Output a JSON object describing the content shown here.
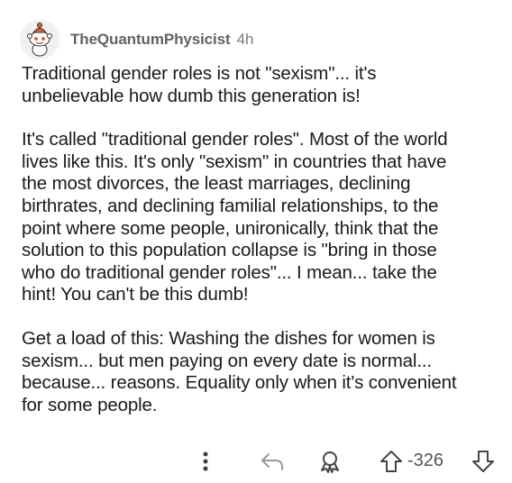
{
  "comment": {
    "username": "TheQuantumPhysicist",
    "timestamp": "4h",
    "paragraphs": [
      "Traditional gender roles is not \"sexism\"... it's\nunbelievable how dumb this generation is!",
      "It's called \"traditional gender roles\". Most of the world\nlives like this. It's only \"sexism\" in countries that have\nthe most divorces, the least marriages, declining\nbirthrates, and declining familial relationships, to the\npoint where some people, unironically, think that the\nsolution to this population collapse is \"bring in those\nwho do traditional gender roles\"... I mean... take the\nhint! You can't be this dumb!",
      "Get a load of this: Washing the dishes for women is\nsexism... but men paying on every date is normal...\nbecause... reasons. Equality only when it's convenient\nfor some people."
    ],
    "score": "-326"
  },
  "icons": {
    "avatar": "snoo-avatar-icon",
    "more": "more-options-icon",
    "reply": "reply-icon",
    "award": "award-icon",
    "upvote": "upvote-arrow-icon",
    "downvote": "downvote-arrow-icon"
  },
  "colors": {
    "text": "#1a1a1b",
    "meta": "#7c7c7c",
    "icon": "#878a8c",
    "avatar_accent": "#e8602c"
  }
}
